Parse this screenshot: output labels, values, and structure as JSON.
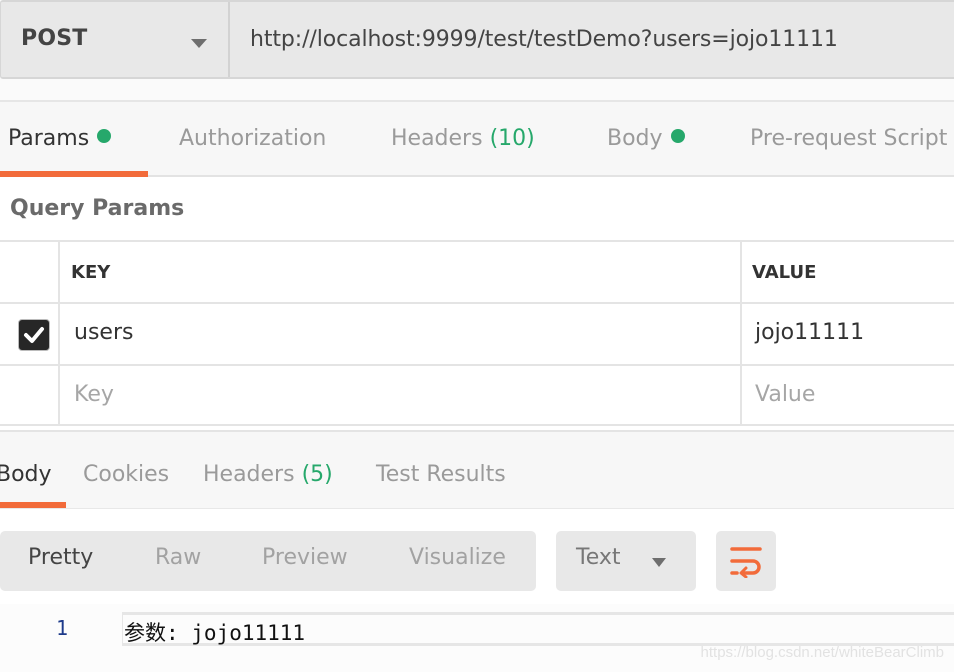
{
  "request": {
    "method": "POST",
    "url": "http://localhost:9999/test/testDemo?users=jojo11111"
  },
  "request_tabs": [
    {
      "label": "Params",
      "active": true,
      "dot": true
    },
    {
      "label": "Authorization",
      "active": false
    },
    {
      "label": "Headers",
      "count": "(10)",
      "active": false
    },
    {
      "label": "Body",
      "active": false,
      "dot": true
    },
    {
      "label": "Pre-request Script",
      "active": false
    }
  ],
  "query_params": {
    "title": "Query Params",
    "headers": {
      "key": "KEY",
      "value": "VALUE"
    },
    "rows": [
      {
        "checked": true,
        "key": "users",
        "value": "jojo11111"
      }
    ],
    "placeholder": {
      "key": "Key",
      "value": "Value"
    }
  },
  "response_tabs": [
    {
      "label": "Body",
      "active": true
    },
    {
      "label": "Cookies",
      "active": false
    },
    {
      "label": "Headers",
      "count": "(5)",
      "active": false
    },
    {
      "label": "Test Results",
      "active": false
    }
  ],
  "body_toolbar": {
    "view_modes": [
      "Pretty",
      "Raw",
      "Preview",
      "Visualize"
    ],
    "active_view": "Pretty",
    "format": "Text",
    "wrap_icon": "wrap-lines-icon"
  },
  "response_body": {
    "lines": [
      {
        "number": "1",
        "text": "参数: jojo11111"
      }
    ]
  },
  "watermark": "https://blog.csdn.net/whiteBearClimb",
  "colors": {
    "accent": "#f26b3a",
    "success": "#26a86b"
  }
}
